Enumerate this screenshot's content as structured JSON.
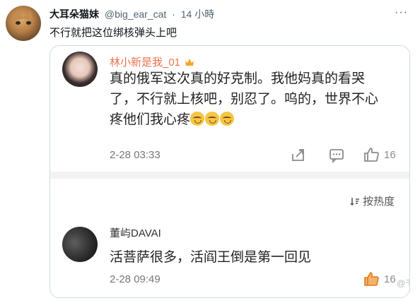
{
  "tweet": {
    "author_name": "大耳朵猫妹",
    "handle": "@big_ear_cat",
    "separator": "·",
    "time": "14 小時",
    "more_label": "···",
    "text": "不行就把这位绑核弹头上吧"
  },
  "embedded": {
    "comment1": {
      "user": "林小新是我_01",
      "text_line1": "真的俄军这次真的好克制。我他妈真的看哭",
      "text_line2": "了，不行就上核吧，别忍了。呜的，世界不心",
      "text_line3": "疼他们我心疼",
      "emoji_count": 3,
      "emoji_name": "crying-face-icon",
      "time": "2-28 03:33",
      "like_count": "16"
    },
    "sort_label": "按热度",
    "comment2": {
      "user": "董屿DAVAI",
      "text": "活菩萨很多，活阎王倒是第一回见",
      "time": "2-28 09:49",
      "like_count": "16"
    },
    "watermark": "@千手巅"
  },
  "colors": {
    "username_orange": "#eb7350",
    "muted": "#536471",
    "card_border": "#cfd9de"
  }
}
